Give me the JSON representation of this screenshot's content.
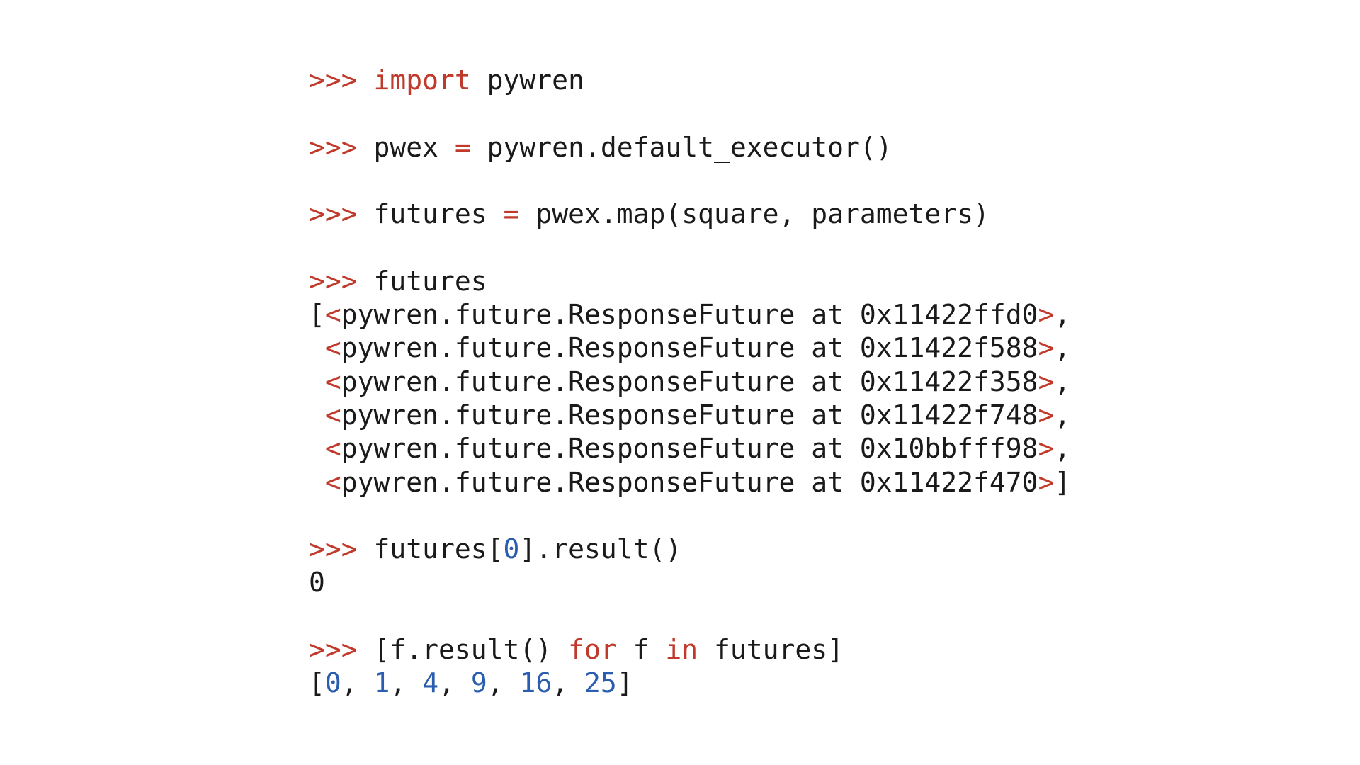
{
  "colors": {
    "prompt": "#c0392b",
    "keyword": "#c0392b",
    "number": "#2a5db0",
    "text": "#1a1a1a",
    "background": "#ffffff"
  },
  "lines": [
    {
      "type": "line",
      "tokens": [
        {
          "t": ">>> ",
          "c": "prompt"
        },
        {
          "t": "import",
          "c": "kw"
        },
        {
          "t": " pywren",
          "c": "text"
        }
      ]
    },
    {
      "type": "blank"
    },
    {
      "type": "line",
      "tokens": [
        {
          "t": ">>> ",
          "c": "prompt"
        },
        {
          "t": "pwex ",
          "c": "text"
        },
        {
          "t": "=",
          "c": "op"
        },
        {
          "t": " pywren.default_executor()",
          "c": "text"
        }
      ]
    },
    {
      "type": "blank"
    },
    {
      "type": "line",
      "tokens": [
        {
          "t": ">>> ",
          "c": "prompt"
        },
        {
          "t": "futures ",
          "c": "text"
        },
        {
          "t": "=",
          "c": "op"
        },
        {
          "t": " pwex.map(square, parameters)",
          "c": "text"
        }
      ]
    },
    {
      "type": "blank"
    },
    {
      "type": "line",
      "tokens": [
        {
          "t": ">>> ",
          "c": "prompt"
        },
        {
          "t": "futures",
          "c": "text"
        }
      ]
    },
    {
      "type": "line",
      "tokens": [
        {
          "t": "[",
          "c": "text"
        },
        {
          "t": "<",
          "c": "angle"
        },
        {
          "t": "pywren.future.ResponseFuture at 0x11422ffd0",
          "c": "text"
        },
        {
          "t": ">",
          "c": "angle"
        },
        {
          "t": ",",
          "c": "text"
        }
      ]
    },
    {
      "type": "line",
      "tokens": [
        {
          "t": " ",
          "c": "text"
        },
        {
          "t": "<",
          "c": "angle"
        },
        {
          "t": "pywren.future.ResponseFuture at 0x11422f588",
          "c": "text"
        },
        {
          "t": ">",
          "c": "angle"
        },
        {
          "t": ",",
          "c": "text"
        }
      ]
    },
    {
      "type": "line",
      "tokens": [
        {
          "t": " ",
          "c": "text"
        },
        {
          "t": "<",
          "c": "angle"
        },
        {
          "t": "pywren.future.ResponseFuture at 0x11422f358",
          "c": "text"
        },
        {
          "t": ">",
          "c": "angle"
        },
        {
          "t": ",",
          "c": "text"
        }
      ]
    },
    {
      "type": "line",
      "tokens": [
        {
          "t": " ",
          "c": "text"
        },
        {
          "t": "<",
          "c": "angle"
        },
        {
          "t": "pywren.future.ResponseFuture at 0x11422f748",
          "c": "text"
        },
        {
          "t": ">",
          "c": "angle"
        },
        {
          "t": ",",
          "c": "text"
        }
      ]
    },
    {
      "type": "line",
      "tokens": [
        {
          "t": " ",
          "c": "text"
        },
        {
          "t": "<",
          "c": "angle"
        },
        {
          "t": "pywren.future.ResponseFuture at 0x10bbfff98",
          "c": "text"
        },
        {
          "t": ">",
          "c": "angle"
        },
        {
          "t": ",",
          "c": "text"
        }
      ]
    },
    {
      "type": "line",
      "tokens": [
        {
          "t": " ",
          "c": "text"
        },
        {
          "t": "<",
          "c": "angle"
        },
        {
          "t": "pywren.future.ResponseFuture at 0x11422f470",
          "c": "text"
        },
        {
          "t": ">",
          "c": "angle"
        },
        {
          "t": "]",
          "c": "text"
        }
      ]
    },
    {
      "type": "blank"
    },
    {
      "type": "line",
      "tokens": [
        {
          "t": ">>> ",
          "c": "prompt"
        },
        {
          "t": "futures[",
          "c": "text"
        },
        {
          "t": "0",
          "c": "num"
        },
        {
          "t": "].result()",
          "c": "text"
        }
      ]
    },
    {
      "type": "line",
      "tokens": [
        {
          "t": "0",
          "c": "text"
        }
      ]
    },
    {
      "type": "blank"
    },
    {
      "type": "line",
      "tokens": [
        {
          "t": ">>> ",
          "c": "prompt"
        },
        {
          "t": "[f.result() ",
          "c": "text"
        },
        {
          "t": "for",
          "c": "kw"
        },
        {
          "t": " f ",
          "c": "text"
        },
        {
          "t": "in",
          "c": "kw"
        },
        {
          "t": " futures]",
          "c": "text"
        }
      ]
    },
    {
      "type": "line",
      "tokens": [
        {
          "t": "[",
          "c": "text"
        },
        {
          "t": "0",
          "c": "num"
        },
        {
          "t": ", ",
          "c": "text"
        },
        {
          "t": "1",
          "c": "num"
        },
        {
          "t": ", ",
          "c": "text"
        },
        {
          "t": "4",
          "c": "num"
        },
        {
          "t": ", ",
          "c": "text"
        },
        {
          "t": "9",
          "c": "num"
        },
        {
          "t": ", ",
          "c": "text"
        },
        {
          "t": "16",
          "c": "num"
        },
        {
          "t": ", ",
          "c": "text"
        },
        {
          "t": "25",
          "c": "num"
        },
        {
          "t": "]",
          "c": "text"
        }
      ]
    }
  ]
}
